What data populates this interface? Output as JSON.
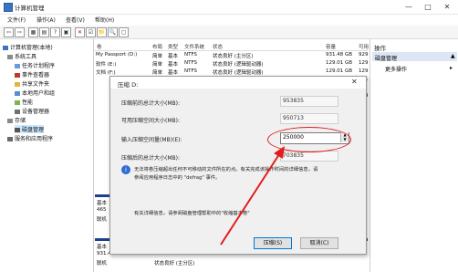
{
  "window": {
    "title": "计算机管理",
    "controls": [
      "—",
      "□",
      "✕"
    ]
  },
  "menu": [
    "文件(F)",
    "操作(A)",
    "查看(V)",
    "帮助(H)"
  ],
  "toolbar": [
    "⇦",
    "⇨",
    "▦",
    "▤",
    "?",
    "▣",
    "✕",
    "☑",
    "📁",
    "🔍",
    "▢"
  ],
  "tree": {
    "root": "计算机管理(本地)",
    "items": [
      {
        "label": "系统工具",
        "level": 1
      },
      {
        "label": "任务计划程序",
        "level": 2
      },
      {
        "label": "事件查看器",
        "level": 2
      },
      {
        "label": "共享文件夹",
        "level": 2
      },
      {
        "label": "本地用户和组",
        "level": 2
      },
      {
        "label": "性能",
        "level": 2
      },
      {
        "label": "设备管理器",
        "level": 2
      },
      {
        "label": "存储",
        "level": 1
      },
      {
        "label": "磁盘管理",
        "level": 2,
        "selected": true
      },
      {
        "label": "服务和应用程序",
        "level": 1
      }
    ]
  },
  "table": {
    "headers": [
      "卷",
      "布局",
      "类型",
      "文件系统",
      "状态",
      "容量",
      "可用"
    ],
    "rows": [
      [
        "My Passport (D:)",
        "简单",
        "基本",
        "NTFS",
        "状态良好 (主分区)",
        "931.48 GB",
        "929"
      ],
      [
        "软件 (E:)",
        "简单",
        "基本",
        "NTFS",
        "状态良好 (逻辑驱动器)",
        "129.01 GB",
        "129"
      ],
      [
        "文档 (F:)",
        "简单",
        "基本",
        "NTFS",
        "状态良好 (逻辑驱动器)",
        "129.01 GB",
        "129"
      ],
      [
        "",
        "",
        "",
        "",
        "",
        "",
        "931"
      ],
      [
        "",
        "",
        "",
        "",
        "",
        "",
        "46"
      ],
      [
        "",
        "",
        "",
        "",
        "",
        "",
        "104"
      ]
    ]
  },
  "lower": {
    "disk_partial": [
      "基本",
      "465",
      "联机"
    ],
    "disk1": [
      "基本",
      "931.48 GB",
      "联机"
    ],
    "disk1_vol": "931.48 GB NTFS",
    "disk1_status": "状态良好 (主分区)"
  },
  "actions": {
    "header": "操作",
    "selected": "磁盘管理",
    "more": "更多操作"
  },
  "dialog": {
    "title": "压缩 D:",
    "close": "✕",
    "label_total": "压缩前的总计大小(MB):",
    "value_total": "953835",
    "label_available": "可用压缩空间大小(MB):",
    "value_available": "950713",
    "label_input": "输入压缩空间量(MB)(E):",
    "input_value": "250000",
    "label_after": "压缩后的总计大小(MB):",
    "value_after": "703835",
    "info_line1": "无法将卷压缩超出任何不可移动的文件所在的点。有关完成该操作时间的详细信息，请",
    "info_line2": "参阅应用程序日志中的 \"defrag\" 事件。",
    "more_info": "有关详细信息，请参阅磁盘管理帮助中的\"收缩基本卷\"",
    "shrink_button": "压缩(S)",
    "cancel_button": "取消(C)"
  }
}
